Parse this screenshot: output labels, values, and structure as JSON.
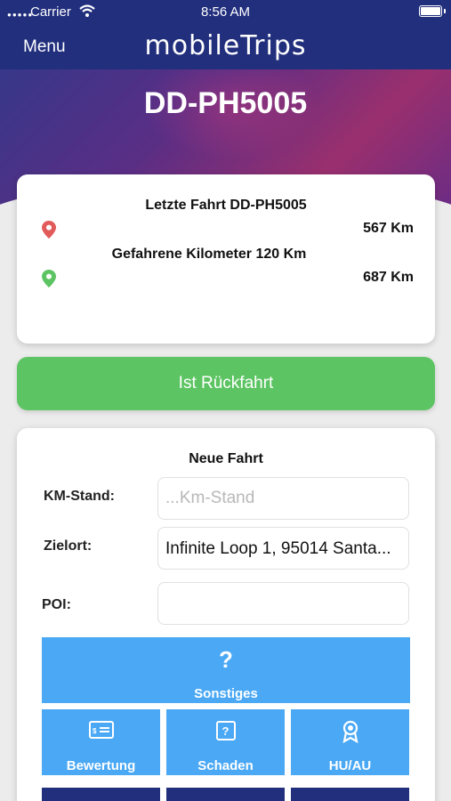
{
  "status_bar": {
    "carrier": "Carrier",
    "time": "8:56 AM"
  },
  "nav": {
    "menu_label": "Menu",
    "app_title": "mobileTrips"
  },
  "vehicle": {
    "plate": "DD-PH5005"
  },
  "last_trip": {
    "heading": "Letzte Fahrt DD-PH5005",
    "start_km": "567 Km",
    "driven_label": "Gefahrene Kilometer 120 Km",
    "end_km": "687 Km"
  },
  "return_button": {
    "label": "Ist Rückfahrt"
  },
  "new_trip": {
    "heading": "Neue Fahrt",
    "km_label": "KM-Stand:",
    "km_placeholder": "...Km-Stand",
    "destination_label": "Zielort:",
    "destination_value": "Infinite Loop 1, 95014 Santa...",
    "poi_label": "POI:",
    "poi_value": ""
  },
  "tiles": {
    "other": {
      "icon": "question-icon",
      "label": "Sonstiges"
    },
    "rating": {
      "icon": "money-card-icon",
      "label": "Bewertung"
    },
    "damage": {
      "icon": "question-box-icon",
      "label": "Schaden"
    },
    "inspection": {
      "icon": "award-icon",
      "label": "HU/AU"
    }
  },
  "colors": {
    "navbar": "#222f7d",
    "tile_blue": "#4aa8f5",
    "return_green": "#5dc463",
    "pin_red": "#e25b5b",
    "pin_green": "#5dc463"
  }
}
